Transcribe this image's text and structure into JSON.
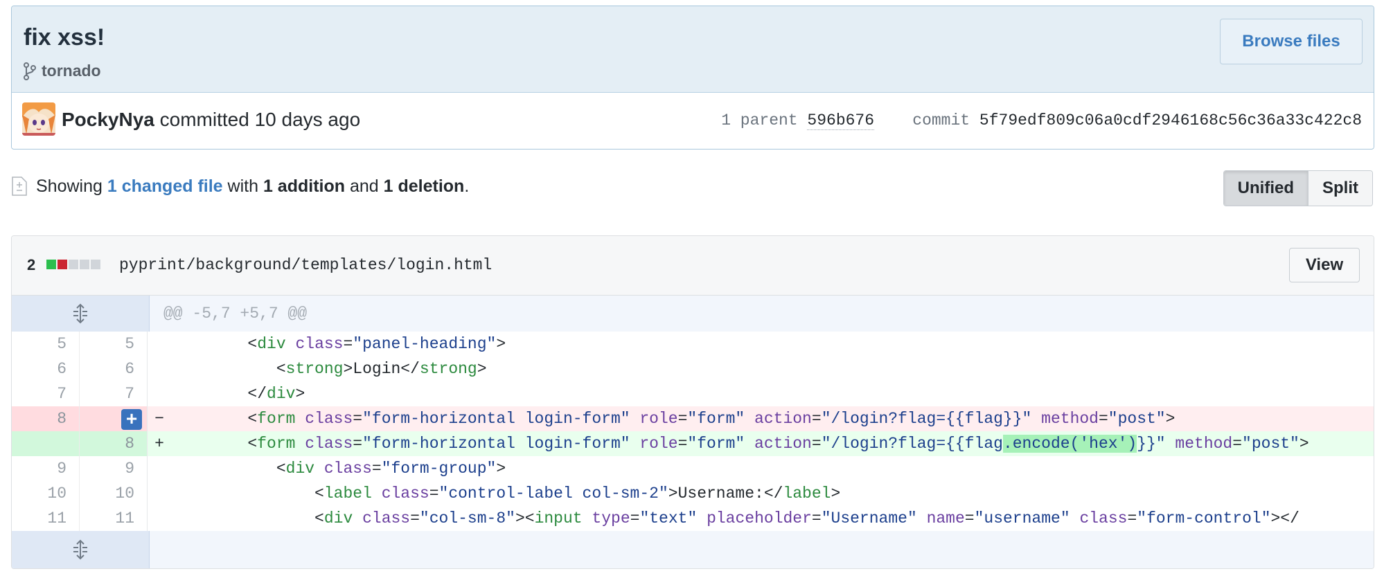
{
  "commit": {
    "title": "fix xss!",
    "branch": "tornado",
    "browse_label": "Browse files",
    "author": "PockyNya",
    "committed_text": "committed 10 days ago",
    "parent_label": "1 parent",
    "parent_sha": "596b676",
    "commit_label": "commit",
    "commit_sha": "5f79edf809c06a0cdf2946168c56c36a33c422c8"
  },
  "summary": {
    "showing": "Showing",
    "changed": "1 changed file",
    "with": "with",
    "additions": "1 addition",
    "and": "and",
    "deletions": "1 deletion",
    "period": "."
  },
  "view_toggle": {
    "unified": "Unified",
    "split": "Split",
    "selected": "Unified"
  },
  "file": {
    "changes": "2",
    "diffstat": [
      "add",
      "del",
      "neutral",
      "neutral",
      "neutral"
    ],
    "path": "pyprint/background/templates/login.html",
    "view_label": "View"
  },
  "diff": {
    "hunk_header": "@@ -5,7 +5,7 @@",
    "lines": [
      {
        "old": "5",
        "new": "5",
        "sign": " ",
        "type": "ctx"
      },
      {
        "old": "6",
        "new": "6",
        "sign": " ",
        "type": "ctx"
      },
      {
        "old": "7",
        "new": "7",
        "sign": " ",
        "type": "ctx"
      },
      {
        "old": "8",
        "new": "",
        "sign": "−",
        "type": "del"
      },
      {
        "old": "",
        "new": "8",
        "sign": "+",
        "type": "add"
      },
      {
        "old": "9",
        "new": "9",
        "sign": " ",
        "type": "ctx"
      },
      {
        "old": "10",
        "new": "10",
        "sign": " ",
        "type": "ctx"
      },
      {
        "old": "11",
        "new": "11",
        "sign": " ",
        "type": "ctx"
      }
    ],
    "code": {
      "l1_indent": "        ",
      "l2_indent": "           ",
      "l4_indent": "               ",
      "lt": "<",
      "gt": ">",
      "slash_lt": "</",
      "eq": "=",
      "close_tag": "\">",
      "div": "div",
      "strong": "strong",
      "form": "form",
      "label": "label",
      "input": "input",
      "class_attr": "class",
      "role_attr": "role",
      "action_attr": "action",
      "method_attr": "method",
      "type_attr": "type",
      "placeholder_attr": "placeholder",
      "name_attr": "name",
      "panel_heading": "\"panel-heading\"",
      "login_text": "Login",
      "form_class": "\"form-horizontal login-form\"",
      "form_role": "\"form\"",
      "action_old": "\"/login?flag={{flag}}\"",
      "action_new_a": "\"/login?flag={{flag",
      "action_new_hl": ".encode('hex')",
      "action_new_b": "}}\"",
      "method_val": "\"post\"",
      "form_group": "\"form-group\"",
      "control_label": "\"control-label col-sm-2\"",
      "username_text": "Username:",
      "col_sm_8": "\"col-sm-8\"",
      "type_text": "\"text\"",
      "placeholder_val": "\"Username\"",
      "name_val": "\"username\"",
      "form_control": "\"form-control\"",
      "tail": "></"
    }
  },
  "colors": {
    "add": "#2cbe4e",
    "del": "#cb2431",
    "neutral": "#d1d5da",
    "link": "#3a7bbf"
  }
}
